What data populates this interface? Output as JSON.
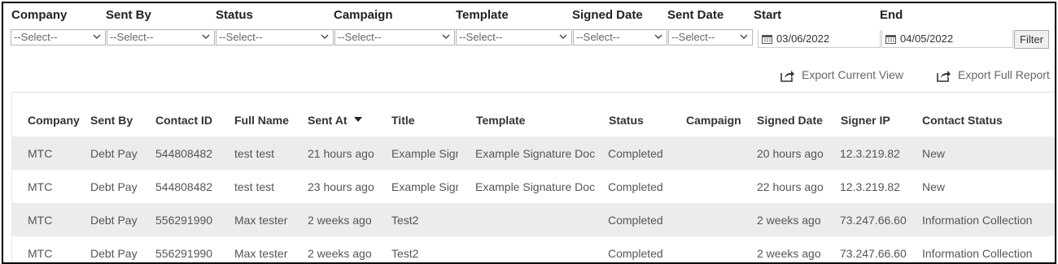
{
  "filters": {
    "labels": {
      "company": "Company",
      "sent_by": "Sent By",
      "status": "Status",
      "campaign": "Campaign",
      "template": "Template",
      "signed_date": "Signed Date",
      "sent_date": "Sent Date",
      "start": "Start",
      "end": "End"
    },
    "select_placeholder": "--Select--",
    "start_date": "03/06/2022",
    "end_date": "04/05/2022",
    "filter_button": "Filter"
  },
  "exports": {
    "current_view": "Export Current View",
    "full_report": "Export Full Report"
  },
  "table": {
    "headers": {
      "company": "Company",
      "sent_by": "Sent By",
      "contact_id": "Contact ID",
      "full_name": "Full Name",
      "sent_at": "Sent At",
      "title": "Title",
      "template": "Template",
      "status": "Status",
      "campaign": "Campaign",
      "signed_date": "Signed Date",
      "signer_ip": "Signer IP",
      "contact_status": "Contact Status"
    },
    "rows": [
      {
        "company": "MTC",
        "sent_by": "Debt Pay",
        "contact_id": "544808482",
        "full_name": "test test",
        "sent_at": "21 hours ago",
        "title": "Example Sign",
        "template": "Example Signature Doc",
        "status": "Completed",
        "campaign": "",
        "signed_date": "20 hours ago",
        "signer_ip": "12.3.219.82",
        "contact_status": "New"
      },
      {
        "company": "MTC",
        "sent_by": "Debt Pay",
        "contact_id": "544808482",
        "full_name": "test test",
        "sent_at": "23 hours ago",
        "title": "Example Sign",
        "template": "Example Signature Doc",
        "status": "Completed",
        "campaign": "",
        "signed_date": "22 hours ago",
        "signer_ip": "12.3.219.82",
        "contact_status": "New"
      },
      {
        "company": "MTC",
        "sent_by": "Debt Pay",
        "contact_id": "556291990",
        "full_name": "Max tester",
        "sent_at": "2 weeks ago",
        "title": "Test2",
        "template": "",
        "status": "Completed",
        "campaign": "",
        "signed_date": "2 weeks ago",
        "signer_ip": "73.247.66.60",
        "contact_status": "Information Collection"
      },
      {
        "company": "MTC",
        "sent_by": "Debt Pay",
        "contact_id": "556291990",
        "full_name": "Max tester",
        "sent_at": "2 weeks ago",
        "title": "Test2",
        "template": "",
        "status": "Completed",
        "campaign": "",
        "signed_date": "2 weeks ago",
        "signer_ip": "73.247.66.60",
        "contact_status": "Information Collection"
      }
    ]
  }
}
